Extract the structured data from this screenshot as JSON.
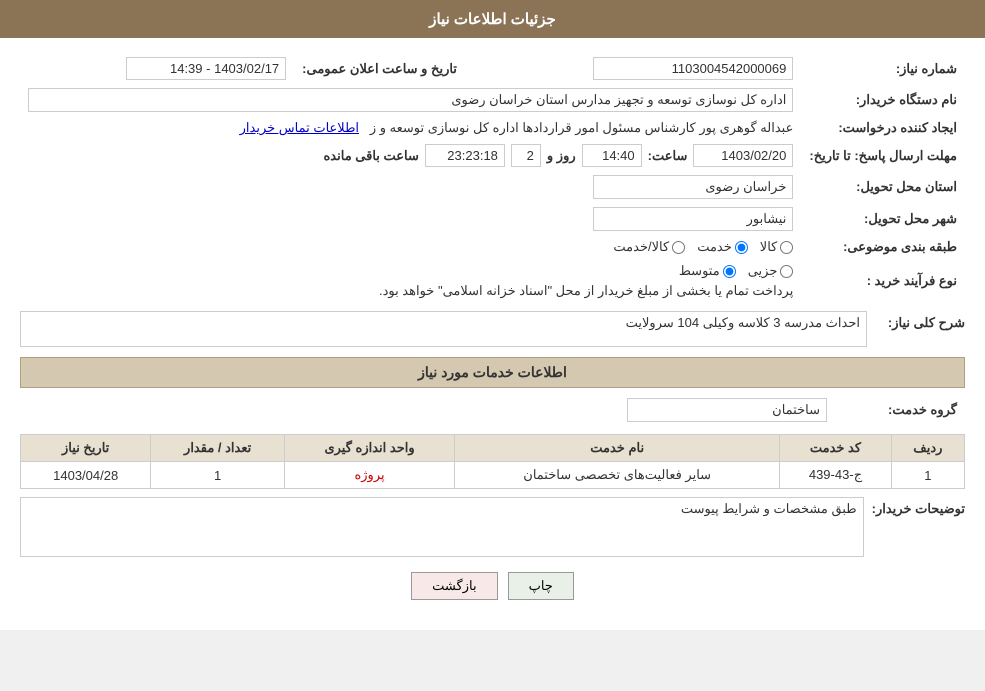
{
  "header": {
    "title": "جزئیات اطلاعات نیاز"
  },
  "fields": {
    "need_number_label": "شماره نیاز:",
    "need_number_value": "1103004542000069",
    "announce_label": "تاریخ و ساعت اعلان عمومی:",
    "announce_value": "1403/02/17 - 14:39",
    "buyer_label": "نام دستگاه خریدار:",
    "buyer_value": "اداره کل نوسازی  توسعه و تجهیز مدارس استان خراسان رضوی",
    "creator_label": "ایجاد کننده درخواست:",
    "creator_value": "عبداله گوهری پور کارشناس مسئول امور قراردادها  اداره کل نوسازی  توسعه و ز",
    "creator_link": "اطلاعات تماس خریدار",
    "deadline_label": "مهلت ارسال پاسخ: تا تاریخ:",
    "deadline_date": "1403/02/20",
    "deadline_time_label": "ساعت:",
    "deadline_time": "14:40",
    "deadline_days_label": "روز و",
    "deadline_days": "2",
    "deadline_remaining_label": "ساعت باقی مانده",
    "deadline_remaining": "23:23:18",
    "province_label": "استان محل تحویل:",
    "province_value": "خراسان رضوی",
    "city_label": "شهر محل تحویل:",
    "city_value": "نیشابور",
    "category_label": "طبقه بندی موضوعی:",
    "category_options": [
      "کالا",
      "خدمت",
      "کالا/خدمت"
    ],
    "category_selected": "خدمت",
    "process_label": "نوع فرآیند خرید :",
    "process_options": [
      "جزیی",
      "متوسط"
    ],
    "process_selected": "متوسط",
    "process_note": "پرداخت تمام یا بخشی از مبلغ خریدار از محل \"اسناد خزانه اسلامی\" خواهد بود.",
    "description_label": "شرح کلی نیاز:",
    "description_value": "احداث مدرسه 3 کلاسه وکیلی 104 سرولایت",
    "services_section": "اطلاعات خدمات مورد نیاز",
    "service_group_label": "گروه خدمت:",
    "service_group_value": "ساختمان",
    "table": {
      "headers": [
        "ردیف",
        "کد خدمت",
        "نام خدمت",
        "واحد اندازه گیری",
        "تعداد / مقدار",
        "تاریخ نیاز"
      ],
      "rows": [
        {
          "row": "1",
          "code": "ج-43-439",
          "name": "سایر فعالیت‌های تخصصی ساختمان",
          "unit": "پروژه",
          "count": "1",
          "date": "1403/04/28"
        }
      ]
    },
    "buyer_desc_label": "توضیحات خریدار:",
    "buyer_desc_value": "طبق مشخصات و شرایط پیوست"
  },
  "buttons": {
    "print": "چاپ",
    "back": "بازگشت"
  }
}
